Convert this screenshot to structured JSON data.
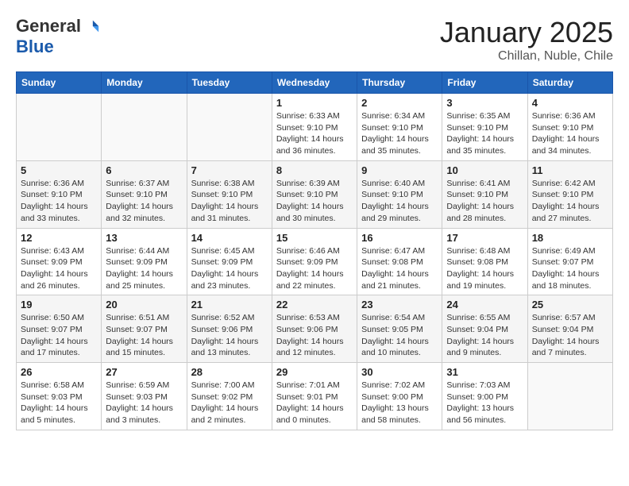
{
  "header": {
    "logo_general": "General",
    "logo_blue": "Blue",
    "month_title": "January 2025",
    "location": "Chillan, Nuble, Chile"
  },
  "weekdays": [
    "Sunday",
    "Monday",
    "Tuesday",
    "Wednesday",
    "Thursday",
    "Friday",
    "Saturday"
  ],
  "weeks": [
    [
      {
        "day": "",
        "sunrise": "",
        "sunset": "",
        "daylight": ""
      },
      {
        "day": "",
        "sunrise": "",
        "sunset": "",
        "daylight": ""
      },
      {
        "day": "",
        "sunrise": "",
        "sunset": "",
        "daylight": ""
      },
      {
        "day": "1",
        "sunrise": "Sunrise: 6:33 AM",
        "sunset": "Sunset: 9:10 PM",
        "daylight": "Daylight: 14 hours and 36 minutes."
      },
      {
        "day": "2",
        "sunrise": "Sunrise: 6:34 AM",
        "sunset": "Sunset: 9:10 PM",
        "daylight": "Daylight: 14 hours and 35 minutes."
      },
      {
        "day": "3",
        "sunrise": "Sunrise: 6:35 AM",
        "sunset": "Sunset: 9:10 PM",
        "daylight": "Daylight: 14 hours and 35 minutes."
      },
      {
        "day": "4",
        "sunrise": "Sunrise: 6:36 AM",
        "sunset": "Sunset: 9:10 PM",
        "daylight": "Daylight: 14 hours and 34 minutes."
      }
    ],
    [
      {
        "day": "5",
        "sunrise": "Sunrise: 6:36 AM",
        "sunset": "Sunset: 9:10 PM",
        "daylight": "Daylight: 14 hours and 33 minutes."
      },
      {
        "day": "6",
        "sunrise": "Sunrise: 6:37 AM",
        "sunset": "Sunset: 9:10 PM",
        "daylight": "Daylight: 14 hours and 32 minutes."
      },
      {
        "day": "7",
        "sunrise": "Sunrise: 6:38 AM",
        "sunset": "Sunset: 9:10 PM",
        "daylight": "Daylight: 14 hours and 31 minutes."
      },
      {
        "day": "8",
        "sunrise": "Sunrise: 6:39 AM",
        "sunset": "Sunset: 9:10 PM",
        "daylight": "Daylight: 14 hours and 30 minutes."
      },
      {
        "day": "9",
        "sunrise": "Sunrise: 6:40 AM",
        "sunset": "Sunset: 9:10 PM",
        "daylight": "Daylight: 14 hours and 29 minutes."
      },
      {
        "day": "10",
        "sunrise": "Sunrise: 6:41 AM",
        "sunset": "Sunset: 9:10 PM",
        "daylight": "Daylight: 14 hours and 28 minutes."
      },
      {
        "day": "11",
        "sunrise": "Sunrise: 6:42 AM",
        "sunset": "Sunset: 9:10 PM",
        "daylight": "Daylight: 14 hours and 27 minutes."
      }
    ],
    [
      {
        "day": "12",
        "sunrise": "Sunrise: 6:43 AM",
        "sunset": "Sunset: 9:09 PM",
        "daylight": "Daylight: 14 hours and 26 minutes."
      },
      {
        "day": "13",
        "sunrise": "Sunrise: 6:44 AM",
        "sunset": "Sunset: 9:09 PM",
        "daylight": "Daylight: 14 hours and 25 minutes."
      },
      {
        "day": "14",
        "sunrise": "Sunrise: 6:45 AM",
        "sunset": "Sunset: 9:09 PM",
        "daylight": "Daylight: 14 hours and 23 minutes."
      },
      {
        "day": "15",
        "sunrise": "Sunrise: 6:46 AM",
        "sunset": "Sunset: 9:09 PM",
        "daylight": "Daylight: 14 hours and 22 minutes."
      },
      {
        "day": "16",
        "sunrise": "Sunrise: 6:47 AM",
        "sunset": "Sunset: 9:08 PM",
        "daylight": "Daylight: 14 hours and 21 minutes."
      },
      {
        "day": "17",
        "sunrise": "Sunrise: 6:48 AM",
        "sunset": "Sunset: 9:08 PM",
        "daylight": "Daylight: 14 hours and 19 minutes."
      },
      {
        "day": "18",
        "sunrise": "Sunrise: 6:49 AM",
        "sunset": "Sunset: 9:07 PM",
        "daylight": "Daylight: 14 hours and 18 minutes."
      }
    ],
    [
      {
        "day": "19",
        "sunrise": "Sunrise: 6:50 AM",
        "sunset": "Sunset: 9:07 PM",
        "daylight": "Daylight: 14 hours and 17 minutes."
      },
      {
        "day": "20",
        "sunrise": "Sunrise: 6:51 AM",
        "sunset": "Sunset: 9:07 PM",
        "daylight": "Daylight: 14 hours and 15 minutes."
      },
      {
        "day": "21",
        "sunrise": "Sunrise: 6:52 AM",
        "sunset": "Sunset: 9:06 PM",
        "daylight": "Daylight: 14 hours and 13 minutes."
      },
      {
        "day": "22",
        "sunrise": "Sunrise: 6:53 AM",
        "sunset": "Sunset: 9:06 PM",
        "daylight": "Daylight: 14 hours and 12 minutes."
      },
      {
        "day": "23",
        "sunrise": "Sunrise: 6:54 AM",
        "sunset": "Sunset: 9:05 PM",
        "daylight": "Daylight: 14 hours and 10 minutes."
      },
      {
        "day": "24",
        "sunrise": "Sunrise: 6:55 AM",
        "sunset": "Sunset: 9:04 PM",
        "daylight": "Daylight: 14 hours and 9 minutes."
      },
      {
        "day": "25",
        "sunrise": "Sunrise: 6:57 AM",
        "sunset": "Sunset: 9:04 PM",
        "daylight": "Daylight: 14 hours and 7 minutes."
      }
    ],
    [
      {
        "day": "26",
        "sunrise": "Sunrise: 6:58 AM",
        "sunset": "Sunset: 9:03 PM",
        "daylight": "Daylight: 14 hours and 5 minutes."
      },
      {
        "day": "27",
        "sunrise": "Sunrise: 6:59 AM",
        "sunset": "Sunset: 9:03 PM",
        "daylight": "Daylight: 14 hours and 3 minutes."
      },
      {
        "day": "28",
        "sunrise": "Sunrise: 7:00 AM",
        "sunset": "Sunset: 9:02 PM",
        "daylight": "Daylight: 14 hours and 2 minutes."
      },
      {
        "day": "29",
        "sunrise": "Sunrise: 7:01 AM",
        "sunset": "Sunset: 9:01 PM",
        "daylight": "Daylight: 14 hours and 0 minutes."
      },
      {
        "day": "30",
        "sunrise": "Sunrise: 7:02 AM",
        "sunset": "Sunset: 9:00 PM",
        "daylight": "Daylight: 13 hours and 58 minutes."
      },
      {
        "day": "31",
        "sunrise": "Sunrise: 7:03 AM",
        "sunset": "Sunset: 9:00 PM",
        "daylight": "Daylight: 13 hours and 56 minutes."
      },
      {
        "day": "",
        "sunrise": "",
        "sunset": "",
        "daylight": ""
      }
    ]
  ]
}
